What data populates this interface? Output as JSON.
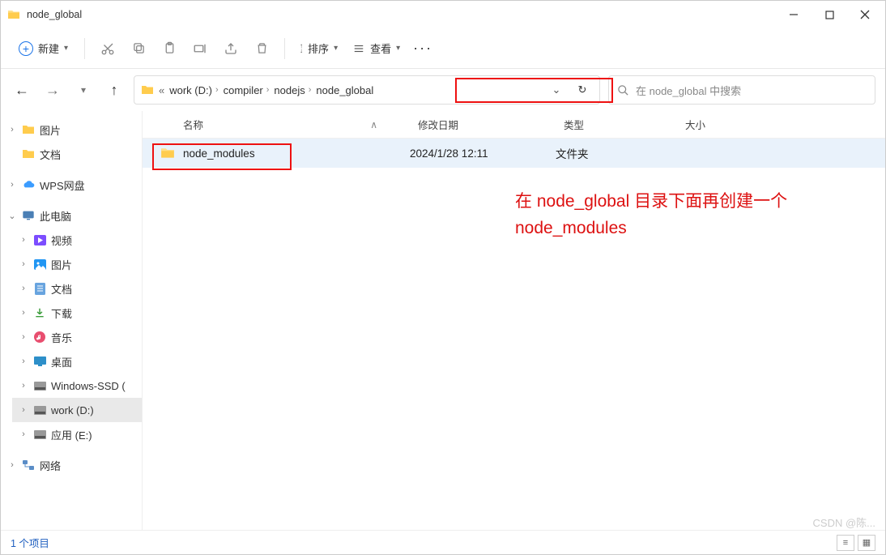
{
  "window": {
    "title": "node_global"
  },
  "toolbar": {
    "new_label": "新建",
    "sort_label": "排序",
    "view_label": "查看"
  },
  "breadcrumb": {
    "root_marker": "«",
    "items": [
      "work (D:)",
      "compiler",
      "nodejs",
      "node_global"
    ]
  },
  "search": {
    "placeholder": "在 node_global 中搜索"
  },
  "sidebar": {
    "quick": [
      {
        "label": "图片",
        "icon": "folder"
      },
      {
        "label": "文档",
        "icon": "folder"
      }
    ],
    "wps": "WPS网盘",
    "pc": "此电脑",
    "pc_children": [
      {
        "label": "视频"
      },
      {
        "label": "图片"
      },
      {
        "label": "文档"
      },
      {
        "label": "下载"
      },
      {
        "label": "音乐"
      },
      {
        "label": "桌面"
      },
      {
        "label": "Windows-SSD ("
      },
      {
        "label": "work (D:)"
      },
      {
        "label": "应用 (E:)"
      }
    ],
    "network": "网络"
  },
  "columns": {
    "name": "名称",
    "date": "修改日期",
    "type": "类型",
    "size": "大小"
  },
  "rows": [
    {
      "name": "node_modules",
      "date": "2024/1/28 12:11",
      "type": "文件夹",
      "size": ""
    }
  ],
  "annotation": {
    "line1": "在 node_global 目录下面再创建一个",
    "line2": "node_modules"
  },
  "status": {
    "count": "1 个项目"
  },
  "watermark": "CSDN @陈..."
}
